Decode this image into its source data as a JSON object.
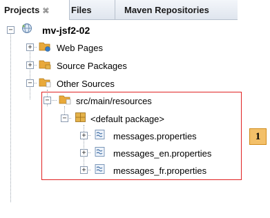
{
  "tabs": [
    {
      "label": "Projects",
      "close": "⌘",
      "active": true
    },
    {
      "label": "Files",
      "active": false
    },
    {
      "label": "Maven Repositories",
      "active": false
    }
  ],
  "tree": {
    "project": "mv-jsf2-02",
    "web_pages": "Web Pages",
    "source_packages": "Source Packages",
    "other_sources": "Other Sources",
    "resources_folder": "src/main/resources",
    "default_package": "<default package>",
    "files": [
      "messages.properties",
      "messages_en.properties",
      "messages_fr.properties"
    ]
  },
  "expander": {
    "collapsed": "+",
    "expanded": "−"
  },
  "callout_badge": "1",
  "colors": {
    "callout_border": "#e02020",
    "badge_fill": "#f3c069",
    "folder": "#e9a93a",
    "package": "#e4b24a"
  }
}
